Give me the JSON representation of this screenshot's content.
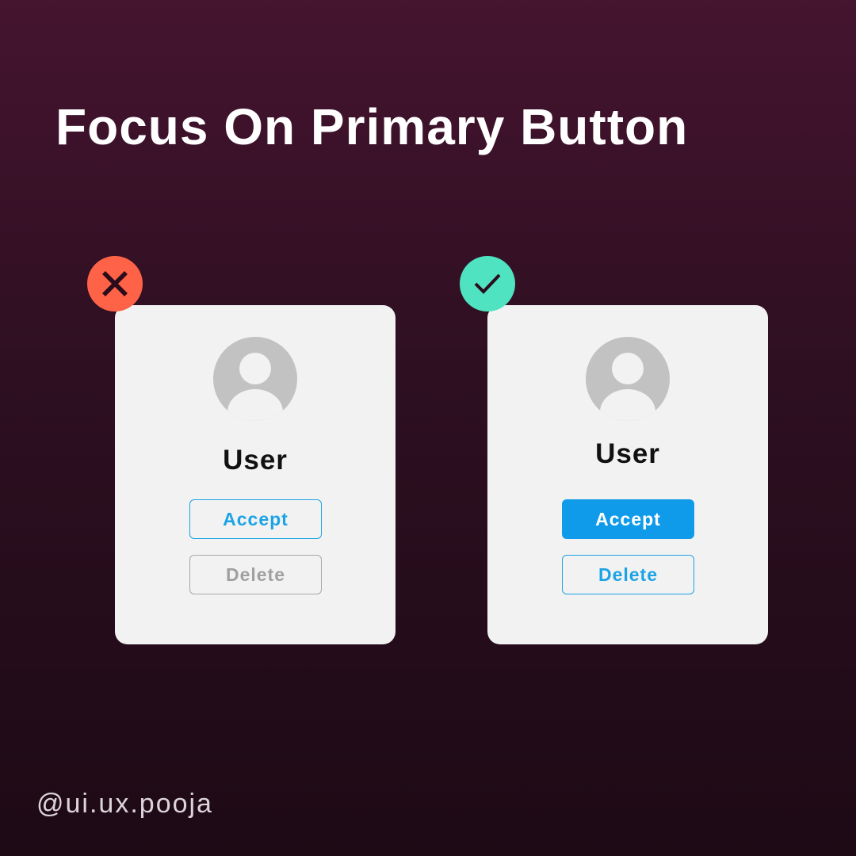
{
  "title": "Focus On Primary Button",
  "colors": {
    "bad_badge": "#ff6347",
    "good_badge": "#4fe3c1",
    "primary_blue": "#0f9bea",
    "card_bg": "#f2f2f2",
    "avatar_gray": "#c2c2c2",
    "muted_gray": "#a0a0a0"
  },
  "examples": [
    {
      "verdict": "bad",
      "badge_icon": "close-icon",
      "user_label": "User",
      "accept_label": "Accept",
      "delete_label": "Delete"
    },
    {
      "verdict": "good",
      "badge_icon": "check-icon",
      "user_label": "User",
      "accept_label": "Accept",
      "delete_label": "Delete"
    }
  ],
  "handle": "@ui.ux.pooja"
}
